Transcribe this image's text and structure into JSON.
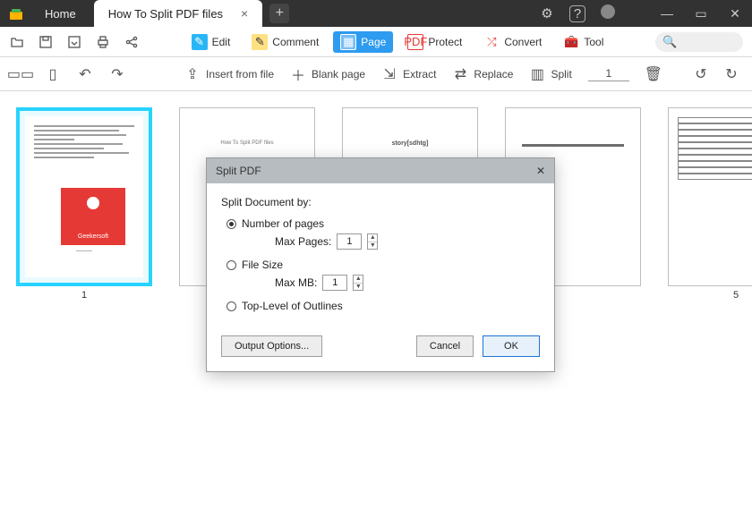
{
  "titlebar": {
    "home": "Home",
    "tab_title": "How To Split PDF files",
    "close_glyph": "×",
    "newtab_glyph": "+",
    "gear_glyph": "⚙",
    "help_glyph": "?",
    "min_glyph": "—",
    "max_glyph": "▭",
    "win_close_glyph": "✕"
  },
  "ribbon": {
    "edit": "Edit",
    "comment": "Comment",
    "page": "Page",
    "protect": "Protect",
    "convert": "Convert",
    "tool": "Tool",
    "search_glyph": "🔍"
  },
  "pagetools": {
    "insert_from_file": "Insert from file",
    "blank_page": "Blank page",
    "extract": "Extract",
    "replace": "Replace",
    "split": "Split",
    "page_number": "1"
  },
  "thumbnails": {
    "page1_label": "1",
    "page1_brand": "Geekersoft",
    "page2_title": "How To Split PDF files",
    "page3_center": "story[sdhtg]",
    "page5_label": "5"
  },
  "dialog": {
    "title": "Split PDF",
    "close_glyph": "✕",
    "split_by_label": "Split Document by:",
    "opt_pages": "Number of pages",
    "max_pages_label": "Max Pages:",
    "max_pages_value": "1",
    "opt_filesize": "File Size",
    "max_mb_label": "Max MB:",
    "max_mb_value": "1",
    "opt_outlines": "Top-Level of Outlines",
    "output_options": "Output Options...",
    "cancel": "Cancel",
    "ok": "OK"
  }
}
